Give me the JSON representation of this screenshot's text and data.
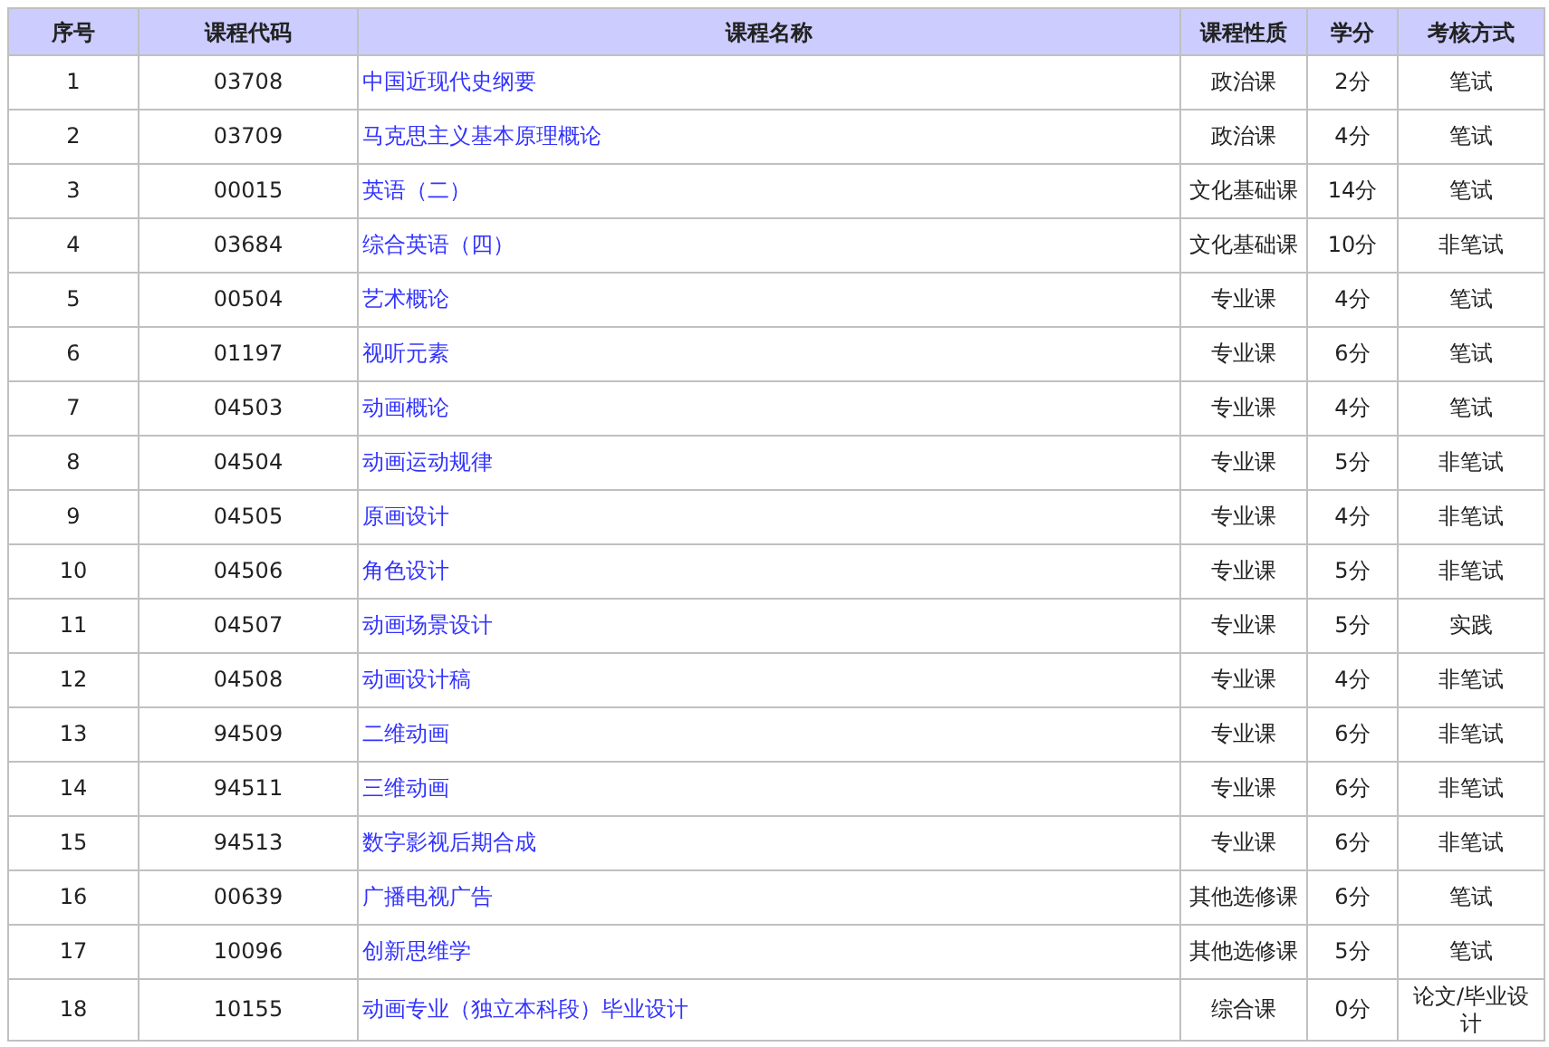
{
  "table": {
    "columns": [
      "序号",
      "课程代码",
      "课程名称",
      "课程性质",
      "学分",
      "考核方式"
    ],
    "rows": [
      [
        "1",
        "03708",
        "中国近现代史纲要",
        "政治课",
        "2分",
        "笔试"
      ],
      [
        "2",
        "03709",
        "马克思主义基本原理概论",
        "政治课",
        "4分",
        "笔试"
      ],
      [
        "3",
        "00015",
        "英语（二）",
        "文化基础课",
        "14分",
        "笔试"
      ],
      [
        "4",
        "03684",
        "综合英语（四）",
        "文化基础课",
        "10分",
        "非笔试"
      ],
      [
        "5",
        "00504",
        "艺术概论",
        "专业课",
        "4分",
        "笔试"
      ],
      [
        "6",
        "01197",
        "视听元素",
        "专业课",
        "6分",
        "笔试"
      ],
      [
        "7",
        "04503",
        "动画概论",
        "专业课",
        "4分",
        "笔试"
      ],
      [
        "8",
        "04504",
        "动画运动规律",
        "专业课",
        "5分",
        "非笔试"
      ],
      [
        "9",
        "04505",
        "原画设计",
        "专业课",
        "4分",
        "非笔试"
      ],
      [
        "10",
        "04506",
        "角色设计",
        "专业课",
        "5分",
        "非笔试"
      ],
      [
        "11",
        "04507",
        "动画场景设计",
        "专业课",
        "5分",
        "实践"
      ],
      [
        "12",
        "04508",
        "动画设计稿",
        "专业课",
        "4分",
        "非笔试"
      ],
      [
        "13",
        "94509",
        "二维动画",
        "专业课",
        "6分",
        "非笔试"
      ],
      [
        "14",
        "94511",
        "三维动画",
        "专业课",
        "6分",
        "非笔试"
      ],
      [
        "15",
        "94513",
        "数字影视后期合成",
        "专业课",
        "6分",
        "非笔试"
      ],
      [
        "16",
        "00639",
        "广播电视广告",
        "其他选修课",
        "6分",
        "笔试"
      ],
      [
        "17",
        "10096",
        "创新思维学",
        "其他选修课",
        "5分",
        "笔试"
      ],
      [
        "18",
        "10155",
        "动画专业（独立本科段）毕业设计",
        "综合课",
        "0分",
        "论文/毕业设计"
      ]
    ]
  }
}
